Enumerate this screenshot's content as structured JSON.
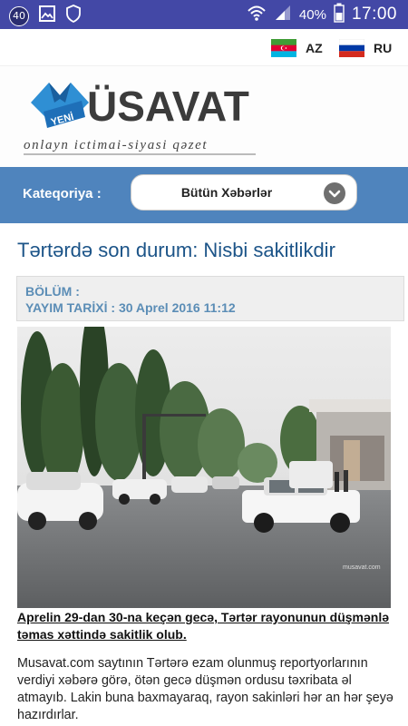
{
  "status_bar": {
    "notification_count": "40",
    "battery": "40%",
    "time": "17:00"
  },
  "languages": [
    {
      "code": "AZ",
      "flag": "azerbaijan-flag"
    },
    {
      "code": "RU",
      "flag": "russia-flag"
    }
  ],
  "brand": {
    "name": "ÜSAVAT",
    "tagline": "onlayn ictimai-siyasi qəzet",
    "emblem_text": "YENİ",
    "colors": {
      "emblem_blue": "#2f8fd4",
      "emblem_dark": "#1a5f9e",
      "wordmark": "#3b3b3b"
    }
  },
  "category": {
    "label": "Kateqoriya :",
    "selected": "Bütün Xəbərlər"
  },
  "article": {
    "title": "Tərtərdə son durum: Nisbi sakitlikdir",
    "section_label": "BÖLÜM :",
    "date_label": "YAYIM TARİXİ : 30 Aprel 2016 11:12",
    "photo_watermark": "musavat.com",
    "lead": "Aprelin 29-dan 30-na keçən gecə, Tərtər rayonunun düşmənlə təmas xəttində sakitlik olub.",
    "body": "Musavat.com saytının Tərtərə ezam olunmuş reportyorlarının verdiyi xəbərə görə, ötən gecə düşmən ordusu təxribata əl atmayıb. Lakin buna baxmayaraq, rayon sakinləri hər an hər şeyə hazırdırlar."
  },
  "theme": {
    "status_bar": "#4348a6",
    "category_bar": "#4f84bd",
    "title_color": "#1c5488",
    "meta_color": "#5b8db6"
  }
}
